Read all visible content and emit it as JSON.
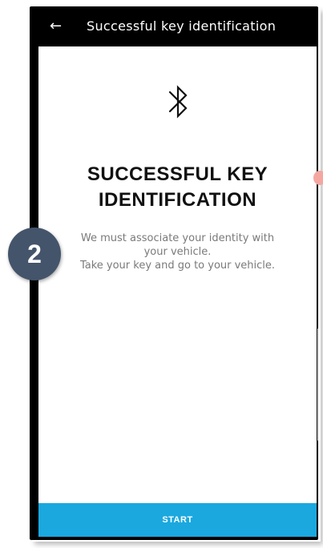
{
  "appbar": {
    "back_icon": "back-arrow-icon",
    "back_glyph": "←",
    "title": "Successful key identification"
  },
  "main": {
    "icon": "bluetooth-icon",
    "heading_line1": "SUCCESSFUL KEY",
    "heading_line2": "IDENTIFICATION",
    "body_line1": "We must associate your identity with",
    "body_line2": "your vehicle.",
    "body_line3": "Take your key and go to your vehicle."
  },
  "footer": {
    "start_label": "START"
  },
  "callout": {
    "step_number": "2"
  },
  "colors": {
    "appbar_bg": "#000000",
    "button_bg": "#1aa8df",
    "badge_bg": "#44546a",
    "body_text": "#7a7a7a"
  }
}
